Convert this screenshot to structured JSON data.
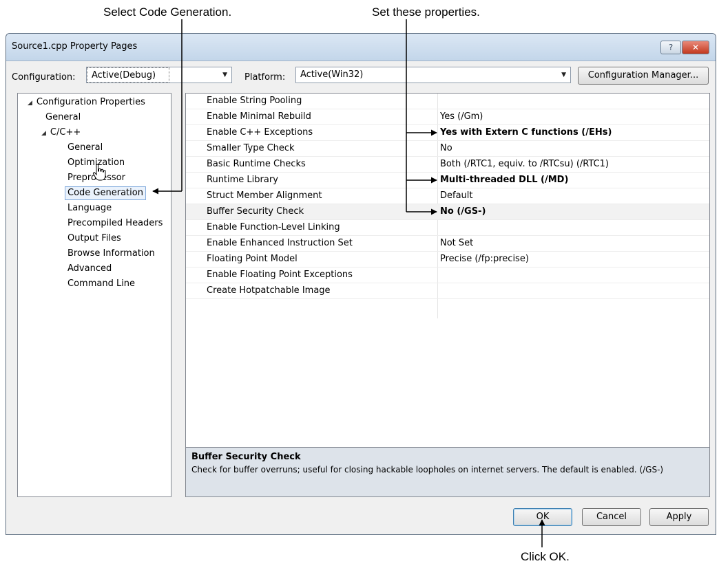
{
  "callouts": {
    "select_code_gen": "Select Code Generation.",
    "set_props": "Set these properties.",
    "click_ok": "Click OK."
  },
  "window": {
    "title": "Source1.cpp Property Pages",
    "help_glyph": "?",
    "close_glyph": "✕"
  },
  "config": {
    "config_label": "Configuration:",
    "config_value": "Active(Debug)",
    "platform_label": "Platform:",
    "platform_value": "Active(Win32)",
    "manager_button": "Configuration Manager..."
  },
  "tree": {
    "root": "Configuration Properties",
    "general": "General",
    "cpp": "C/C++",
    "items": [
      "General",
      "Optimization",
      "Preprocessor",
      "Code Generation",
      "Language",
      "Precompiled Headers",
      "Output Files",
      "Browse Information",
      "Advanced",
      "Command Line"
    ]
  },
  "properties": [
    {
      "name": "Enable String Pooling",
      "value": ""
    },
    {
      "name": "Enable Minimal Rebuild",
      "value": "Yes (/Gm)"
    },
    {
      "name": "Enable C++ Exceptions",
      "value": "Yes with Extern C functions (/EHs)",
      "bold": true
    },
    {
      "name": "Smaller Type Check",
      "value": "No"
    },
    {
      "name": "Basic Runtime Checks",
      "value": "Both (/RTC1, equiv. to /RTCsu) (/RTC1)"
    },
    {
      "name": "Runtime Library",
      "value": "Multi-threaded DLL (/MD)",
      "bold": true
    },
    {
      "name": "Struct Member Alignment",
      "value": "Default"
    },
    {
      "name": "Buffer Security Check",
      "value": "No (/GS-)",
      "bold": true
    },
    {
      "name": "Enable Function-Level Linking",
      "value": ""
    },
    {
      "name": "Enable Enhanced Instruction Set",
      "value": "Not Set"
    },
    {
      "name": "Floating Point Model",
      "value": "Precise (/fp:precise)"
    },
    {
      "name": "Enable Floating Point Exceptions",
      "value": ""
    },
    {
      "name": "Create Hotpatchable Image",
      "value": ""
    }
  ],
  "description": {
    "title": "Buffer Security Check",
    "text": "Check for buffer overruns; useful for closing hackable loopholes on internet servers.  The default is enabled. (/GS-)"
  },
  "buttons": {
    "ok": "OK",
    "cancel": "Cancel",
    "apply": "Apply"
  }
}
